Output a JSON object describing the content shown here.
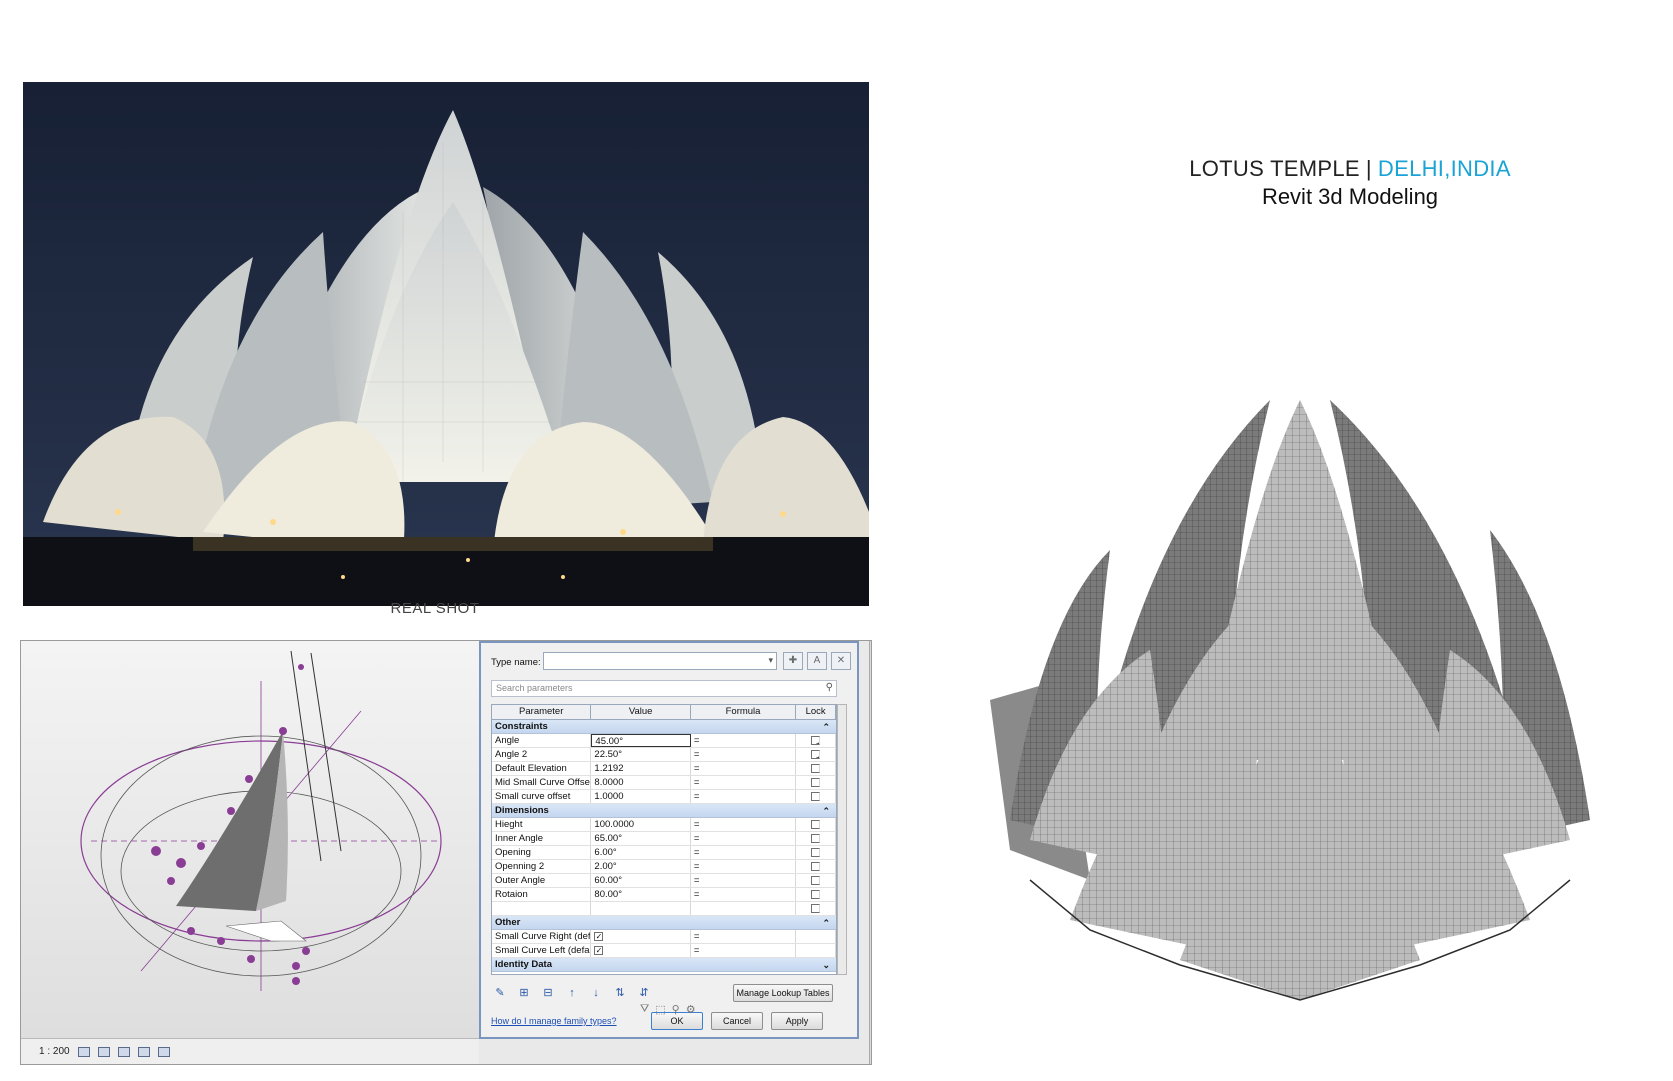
{
  "title": {
    "main": "LOTUS TEMPLE",
    "separator": "|",
    "location": "DELHI,INDIA",
    "subtitle": "Revit 3d Modeling",
    "accent_color": "#1aa3d6"
  },
  "photo": {
    "caption": "REAL SHOT"
  },
  "revit": {
    "scale": "1 : 200",
    "dialog": {
      "type_name_label": "Type name:",
      "type_name_value": "",
      "search_placeholder": "Search parameters",
      "columns": [
        "Parameter",
        "Value",
        "Formula",
        "Lock"
      ],
      "sections": [
        {
          "name": "Constraints",
          "rows": [
            {
              "param": "Angle",
              "value": "45.00°",
              "formula": "=",
              "lock": true
            },
            {
              "param": "Angle 2",
              "value": "22.50°",
              "formula": "=",
              "lock": true
            },
            {
              "param": "Default Elevation",
              "value": "1.2192",
              "formula": "=",
              "lock": false
            },
            {
              "param": "Mid Small Curve Offset",
              "value": "8.0000",
              "formula": "=",
              "lock": false
            },
            {
              "param": "Small curve offset",
              "value": "1.0000",
              "formula": "=",
              "lock": false
            }
          ]
        },
        {
          "name": "Dimensions",
          "rows": [
            {
              "param": "Hieght",
              "value": "100.0000",
              "formula": "=",
              "lock": false
            },
            {
              "param": "Inner Angle",
              "value": "65.00°",
              "formula": "=",
              "lock": false
            },
            {
              "param": "Opening",
              "value": "6.00°",
              "formula": "=",
              "lock": false
            },
            {
              "param": "Openning 2",
              "value": "2.00°",
              "formula": "=",
              "lock": false
            },
            {
              "param": "Outer Angle",
              "value": "60.00°",
              "formula": "=",
              "lock": false
            },
            {
              "param": "Rotaion",
              "value": "80.00°",
              "formula": "=",
              "lock": false
            }
          ]
        },
        {
          "name": "Other",
          "rows": [
            {
              "param": "Small Curve Right (defa",
              "value": "check",
              "formula": "=",
              "lock": null
            },
            {
              "param": "Small Curve Left (default",
              "value": "check",
              "formula": "=",
              "lock": null
            }
          ]
        },
        {
          "name": "Identity Data",
          "rows": []
        }
      ],
      "manage_button": "Manage Lookup Tables",
      "help_link": "How do I manage family types?",
      "ok_label": "OK",
      "cancel_label": "Cancel",
      "apply_label": "Apply"
    }
  }
}
